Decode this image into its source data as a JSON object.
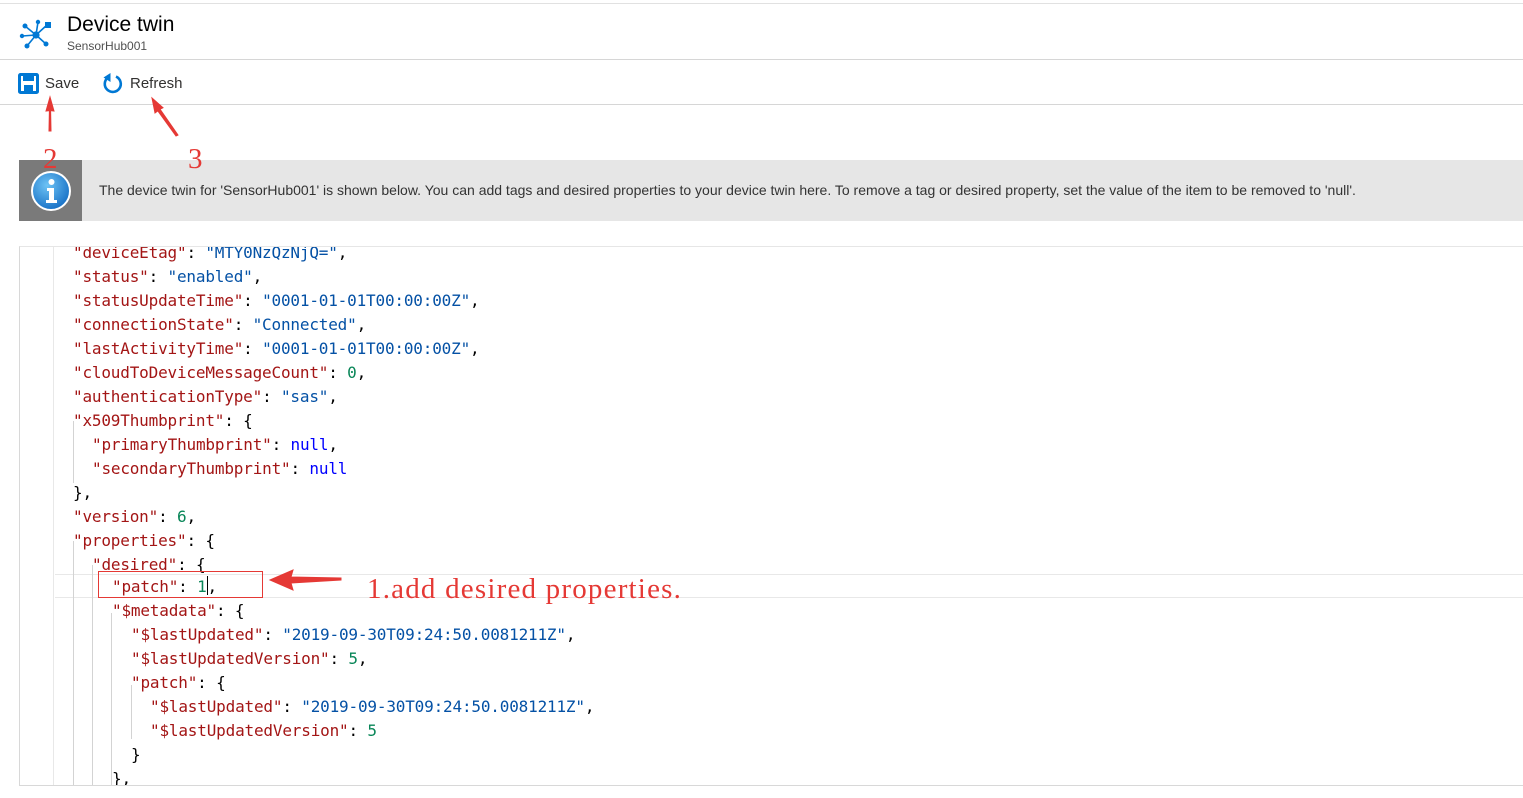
{
  "header": {
    "title": "Device twin",
    "subtitle": "SensorHub001",
    "icon": "iot-hub-icon",
    "accent_color": "#0078d4"
  },
  "toolbar": {
    "save_label": "Save",
    "refresh_label": "Refresh"
  },
  "info_bar": {
    "icon": "info-icon",
    "text": "The device twin for 'SensorHub001' is shown below. You can add tags and desired properties to your device twin here. To remove a tag or desired property, set the value of the item to be removed to 'null'."
  },
  "editor": {
    "lines": [
      [
        [
          "k",
          "\"deviceEtag\""
        ],
        [
          "p",
          ": "
        ],
        [
          "s",
          "\"MTY0NzQzNjQ=\""
        ],
        [
          "p",
          ","
        ]
      ],
      [
        [
          "k",
          "\"status\""
        ],
        [
          "p",
          ": "
        ],
        [
          "s",
          "\"enabled\""
        ],
        [
          "p",
          ","
        ]
      ],
      [
        [
          "k",
          "\"statusUpdateTime\""
        ],
        [
          "p",
          ": "
        ],
        [
          "s",
          "\"0001-01-01T00:00:00Z\""
        ],
        [
          "p",
          ","
        ]
      ],
      [
        [
          "k",
          "\"connectionState\""
        ],
        [
          "p",
          ": "
        ],
        [
          "s",
          "\"Connected\""
        ],
        [
          "p",
          ","
        ]
      ],
      [
        [
          "k",
          "\"lastActivityTime\""
        ],
        [
          "p",
          ": "
        ],
        [
          "s",
          "\"0001-01-01T00:00:00Z\""
        ],
        [
          "p",
          ","
        ]
      ],
      [
        [
          "k",
          "\"cloudToDeviceMessageCount\""
        ],
        [
          "p",
          ": "
        ],
        [
          "n",
          "0"
        ],
        [
          "p",
          ","
        ]
      ],
      [
        [
          "k",
          "\"authenticationType\""
        ],
        [
          "p",
          ": "
        ],
        [
          "s",
          "\"sas\""
        ],
        [
          "p",
          ","
        ]
      ],
      [
        [
          "k",
          "\"x509Thumbprint\""
        ],
        [
          "p",
          ": {"
        ]
      ],
      [
        [
          "k",
          "\"primaryThumbprint\""
        ],
        [
          "p",
          ": "
        ],
        [
          "l",
          "null"
        ],
        [
          "p",
          ","
        ]
      ],
      [
        [
          "k",
          "\"secondaryThumbprint\""
        ],
        [
          "p",
          ": "
        ],
        [
          "l",
          "null"
        ]
      ],
      [
        [
          "p",
          "},"
        ]
      ],
      [
        [
          "k",
          "\"version\""
        ],
        [
          "p",
          ": "
        ],
        [
          "n",
          "6"
        ],
        [
          "p",
          ","
        ]
      ],
      [
        [
          "k",
          "\"properties\""
        ],
        [
          "p",
          ": {"
        ]
      ],
      [
        [
          "k",
          "\"desired\""
        ],
        [
          "p",
          ": {"
        ]
      ],
      [
        [
          "k",
          "\"patch\""
        ],
        [
          "p",
          ": "
        ],
        [
          "n",
          "1"
        ],
        [
          "c",
          ""
        ],
        [
          "p",
          ","
        ]
      ],
      [
        [
          "k",
          "\"$metadata\""
        ],
        [
          "p",
          ": {"
        ]
      ],
      [
        [
          "k",
          "\"$lastUpdated\""
        ],
        [
          "p",
          ": "
        ],
        [
          "s",
          "\"2019-09-30T09:24:50.0081211Z\""
        ],
        [
          "p",
          ","
        ]
      ],
      [
        [
          "k",
          "\"$lastUpdatedVersion\""
        ],
        [
          "p",
          ": "
        ],
        [
          "n",
          "5"
        ],
        [
          "p",
          ","
        ]
      ],
      [
        [
          "k",
          "\"patch\""
        ],
        [
          "p",
          ": {"
        ]
      ],
      [
        [
          "k",
          "\"$lastUpdated\""
        ],
        [
          "p",
          ": "
        ],
        [
          "s",
          "\"2019-09-30T09:24:50.0081211Z\""
        ],
        [
          "p",
          ","
        ]
      ],
      [
        [
          "k",
          "\"$lastUpdatedVersion\""
        ],
        [
          "p",
          ": "
        ],
        [
          "n",
          "5"
        ]
      ],
      [
        [
          "p",
          "}"
        ]
      ],
      [
        [
          "p",
          "},"
        ]
      ]
    ]
  },
  "annotations": {
    "step1_text": "1.add desired properties.",
    "step2_label": "2",
    "step3_label": "3",
    "color": "#e53935"
  }
}
